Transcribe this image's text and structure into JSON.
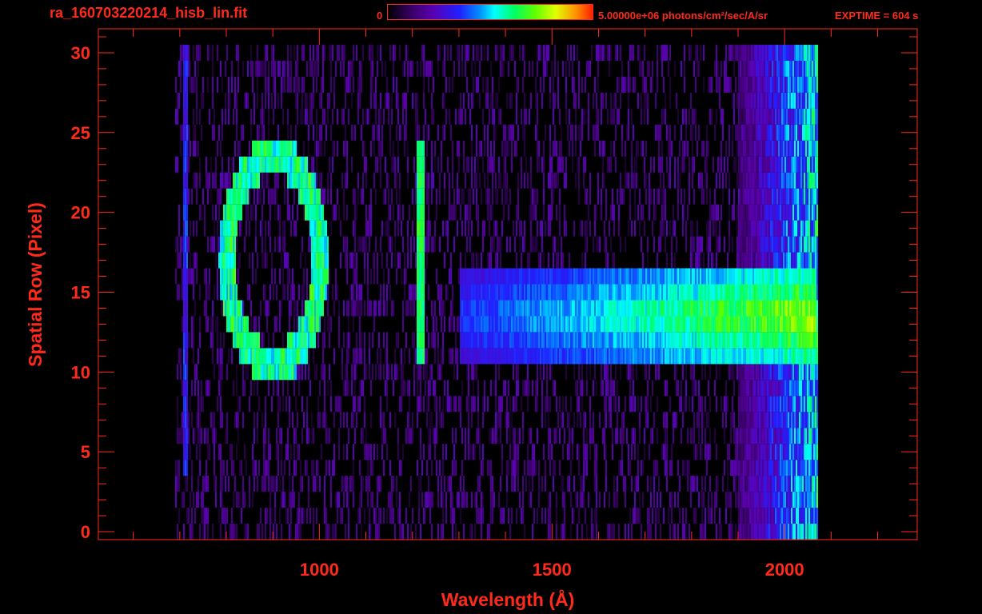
{
  "header": {
    "filename": "ra_160703220214_hisb_lin.fit",
    "colorbar_min": "0",
    "colorbar_max": "5.00000e+06 photons/cm²/sec/A/sr",
    "exptime": "EXPTIME = 604 s"
  },
  "colors": {
    "axis": "#ff2a1a",
    "background": "#000000"
  },
  "chart_data": {
    "type": "heatmap",
    "title": "ra_160703220214_hisb_lin.fit",
    "xlabel": "Wavelength (Å)",
    "ylabel": "Spatial Row (Pixel)",
    "xlim": [
      525,
      2285
    ],
    "ylim": [
      -0.5,
      31.5
    ],
    "x_ticks": [
      1000,
      1500,
      2000
    ],
    "y_ticks": [
      0,
      5,
      10,
      15,
      20,
      25,
      30
    ],
    "colorbar": {
      "min": 0,
      "max": 5000000,
      "units": "photons/cm²/sec/A/sr",
      "colormap": "rainbow"
    },
    "exposure_time_s": 604,
    "detector_extent": {
      "wavelength_min": 690,
      "wavelength_max": 2070,
      "row_min": 0,
      "row_max": 30
    },
    "features": [
      {
        "wavelength": 710,
        "rows": [
          4,
          30
        ],
        "intensity": 0.35
      },
      {
        "wavelength_center": 900,
        "wavelength_halfwidth": 100,
        "row_center": 17,
        "row_halfwidth": 6.5,
        "shape": "ring",
        "intensity": 0.62
      },
      {
        "wavelength": 1216,
        "rows": [
          11,
          24
        ],
        "intensity": 0.62
      },
      {
        "wavelength_range": [
          1300,
          2065
        ],
        "rows": [
          11,
          16
        ],
        "intensity_start": 0.38,
        "intensity_end": 0.8
      },
      {
        "wavelength_range": [
          1900,
          2070
        ],
        "rows": [
          0,
          30
        ],
        "intensity": 0.55
      }
    ]
  }
}
